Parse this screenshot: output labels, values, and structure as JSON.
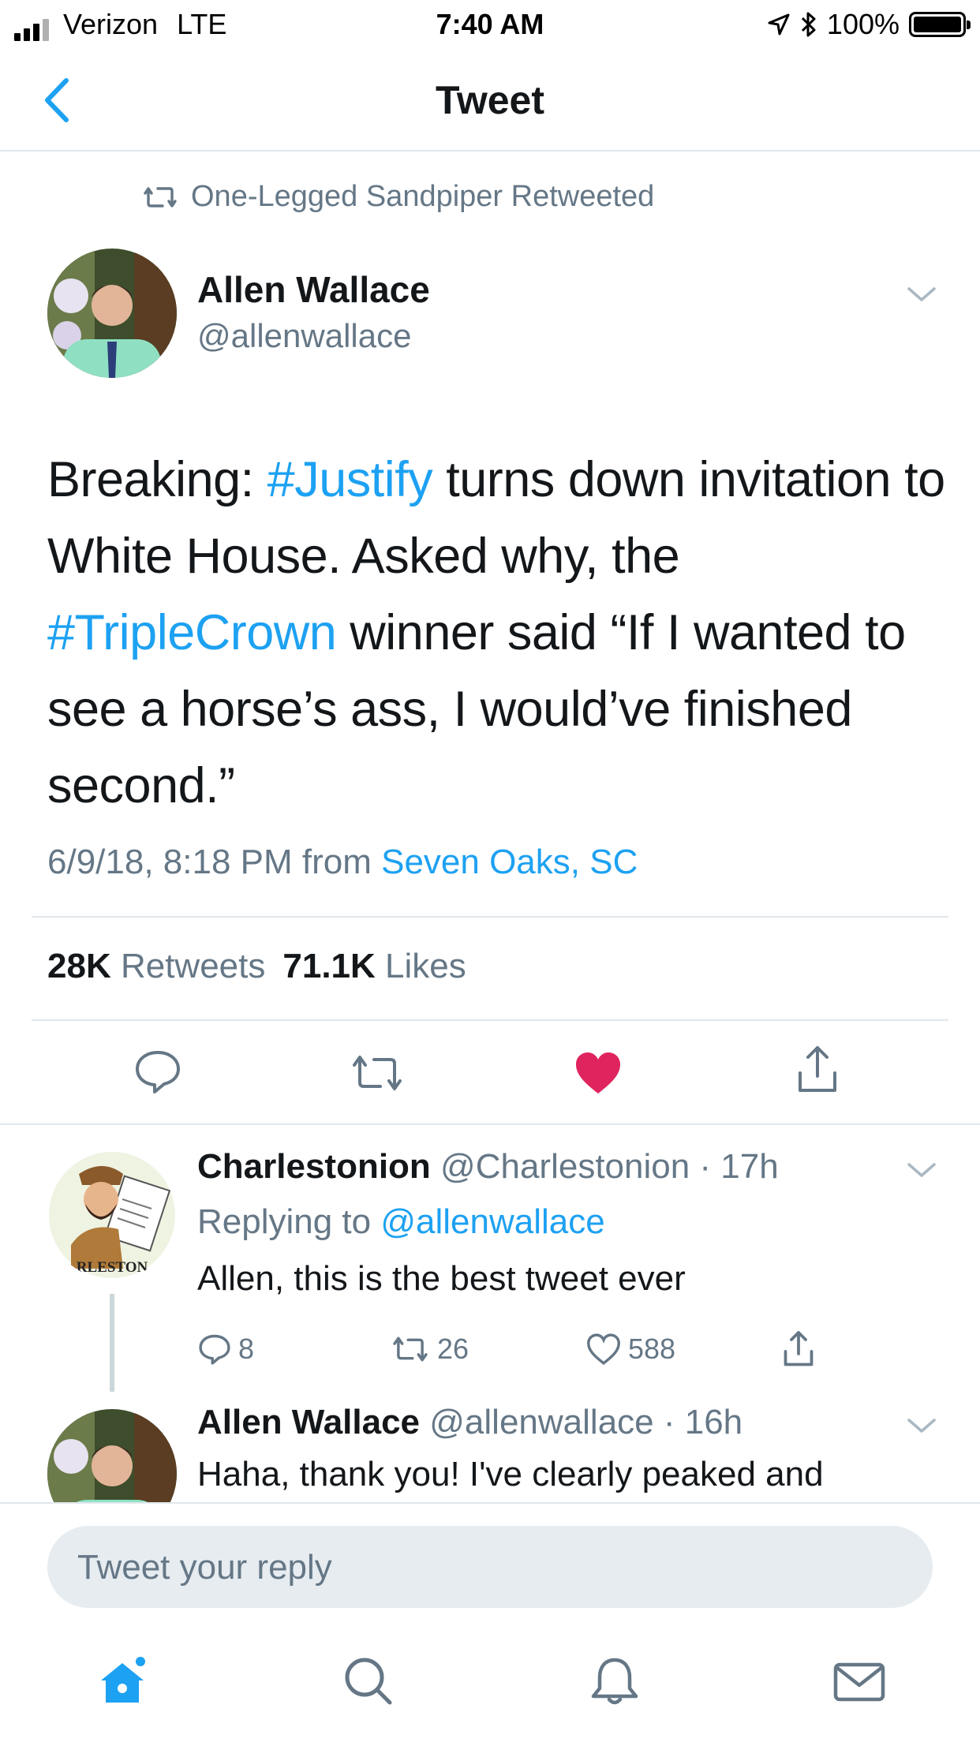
{
  "status_bar": {
    "carrier": "Verizon",
    "network": "LTE",
    "time": "7:40 AM",
    "battery": "100%"
  },
  "nav": {
    "title": "Tweet"
  },
  "retweet_context": "One-Legged Sandpiper Retweeted",
  "tweet": {
    "author_name": "Allen Wallace",
    "author_handle": "@allenwallace",
    "text": {
      "p1": "Breaking: ",
      "tag1": "#Justify",
      "p2": " turns down invitation to White House. Asked why, the ",
      "tag2": "#TripleCrown",
      "p3": " winner said “If I wanted to see a horse’s ass, I would’ve finished second.”"
    },
    "timestamp": "6/9/18, 8:18 PM from ",
    "location": "Seven Oaks, SC",
    "retweets_count": "28K",
    "retweets_label": "Retweets",
    "likes_count": "71.1K",
    "likes_label": "Likes",
    "liked": true
  },
  "replies": [
    {
      "name": "Charlestonion",
      "handle_time": "@Charlestonion · 17h",
      "replying_label": "Replying to ",
      "replying_to": "@allenwallace",
      "text": "Allen, this is the best tweet ever",
      "reply_count": "8",
      "retweet_count": "26",
      "like_count": "588",
      "avatar_text": "RLESTON"
    },
    {
      "name": "Allen Wallace",
      "handle_time": "@allenwallace · 16h",
      "text": "Haha, thank you! I've clearly peaked and"
    }
  ],
  "compose": {
    "placeholder": "Tweet your reply"
  },
  "icons": {
    "back": "chevron-left-icon",
    "retweet": "retweet-icon",
    "reply": "reply-icon",
    "like": "heart-icon",
    "share": "share-icon",
    "home": "home-icon",
    "search": "search-icon",
    "notifications": "bell-icon",
    "messages": "mail-icon"
  },
  "colors": {
    "accent": "#1da1f2",
    "like": "#e0245e",
    "muted": "#657786",
    "text": "#14171a"
  }
}
